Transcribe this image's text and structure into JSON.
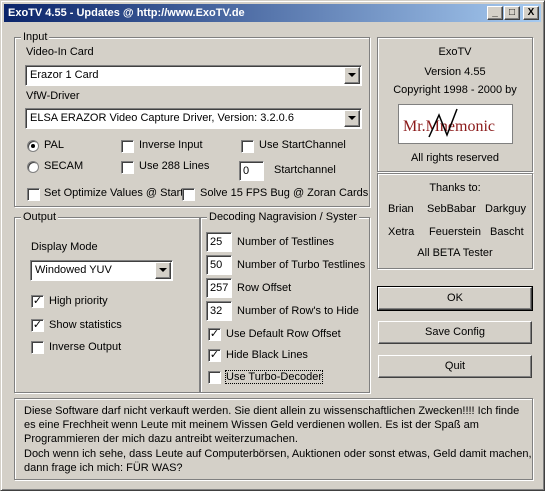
{
  "window": {
    "title": "ExoTV 4.55 - Updates @ http://www.ExoTV.de",
    "minimize": "_",
    "maximize": "□",
    "close": "X"
  },
  "input": {
    "group_title": "Input",
    "video_in_label": "Video-In Card",
    "video_in_value": "Erazor 1 Card",
    "vfw_label": "VfW-Driver",
    "vfw_value": "ELSA ERAZOR Video Capture Driver,   Version:  3.2.0.6",
    "pal_label": "PAL",
    "secam_label": "SECAM",
    "inverse_input_label": "Inverse Input",
    "use_288_label": "Use 288 Lines",
    "use_startchannel_label": "Use StartChannel",
    "startchannel_value": "0",
    "startchannel_label": "Startchannel",
    "optimize_label": "Set Optimize Values @ Start",
    "solve_fps_label": "Solve 15 FPS Bug @ Zoran Cards"
  },
  "about": {
    "name": "ExoTV",
    "version": "Version 4.55",
    "copyright": "Copyright 1998 - 2000 by",
    "logo_text": "Mr.Mnemonic",
    "rights": "All rights reserved",
    "thanks_title": "Thanks to:",
    "thanks_row1": [
      "Brian",
      "SebBabar",
      "Darkguy"
    ],
    "thanks_row2": [
      "Xetra",
      "Feuerstein",
      "Bascht"
    ],
    "beta_tester": "All BETA Tester"
  },
  "output": {
    "group_title": "Output",
    "display_mode_label": "Display Mode",
    "display_mode_value": "Windowed YUV",
    "high_priority_label": "High priority",
    "show_statistics_label": "Show statistics",
    "inverse_output_label": "Inverse Output"
  },
  "decoding": {
    "group_title": "Decoding Nagravision / Syster",
    "testlines_value": "25",
    "testlines_label": "Number of Testlines",
    "turbo_value": "50",
    "turbo_label": "Number of Turbo Testlines",
    "row_offset_value": "257",
    "row_offset_label": "Row Offset",
    "rows_hide_value": "32",
    "rows_hide_label": "Number of Row's to Hide",
    "default_offset_label": "Use Default Row Offset",
    "hide_black_label": "Hide Black Lines",
    "turbo_decoder_label": "Use Turbo-Decoder"
  },
  "buttons": {
    "ok": "OK",
    "save_config": "Save Config",
    "quit": "Quit"
  },
  "notice": {
    "line1": "Diese Software darf nicht verkauft werden. Sie dient allein zu wissenschaftlichen Zwecken!!!! Ich finde",
    "line2": "es eine Frechheit wenn Leute mit meinem Wissen Geld verdienen wollen. Es ist der Spaß am",
    "line3": "Programmieren der mich dazu antreibt weiterzumachen.",
    "line4": "Doch wenn ich sehe, dass Leute auf Computerbörsen, Auktionen oder sonst etwas, Geld damit machen,",
    "line5": "dann frage ich mich: FÜR WAS?"
  }
}
